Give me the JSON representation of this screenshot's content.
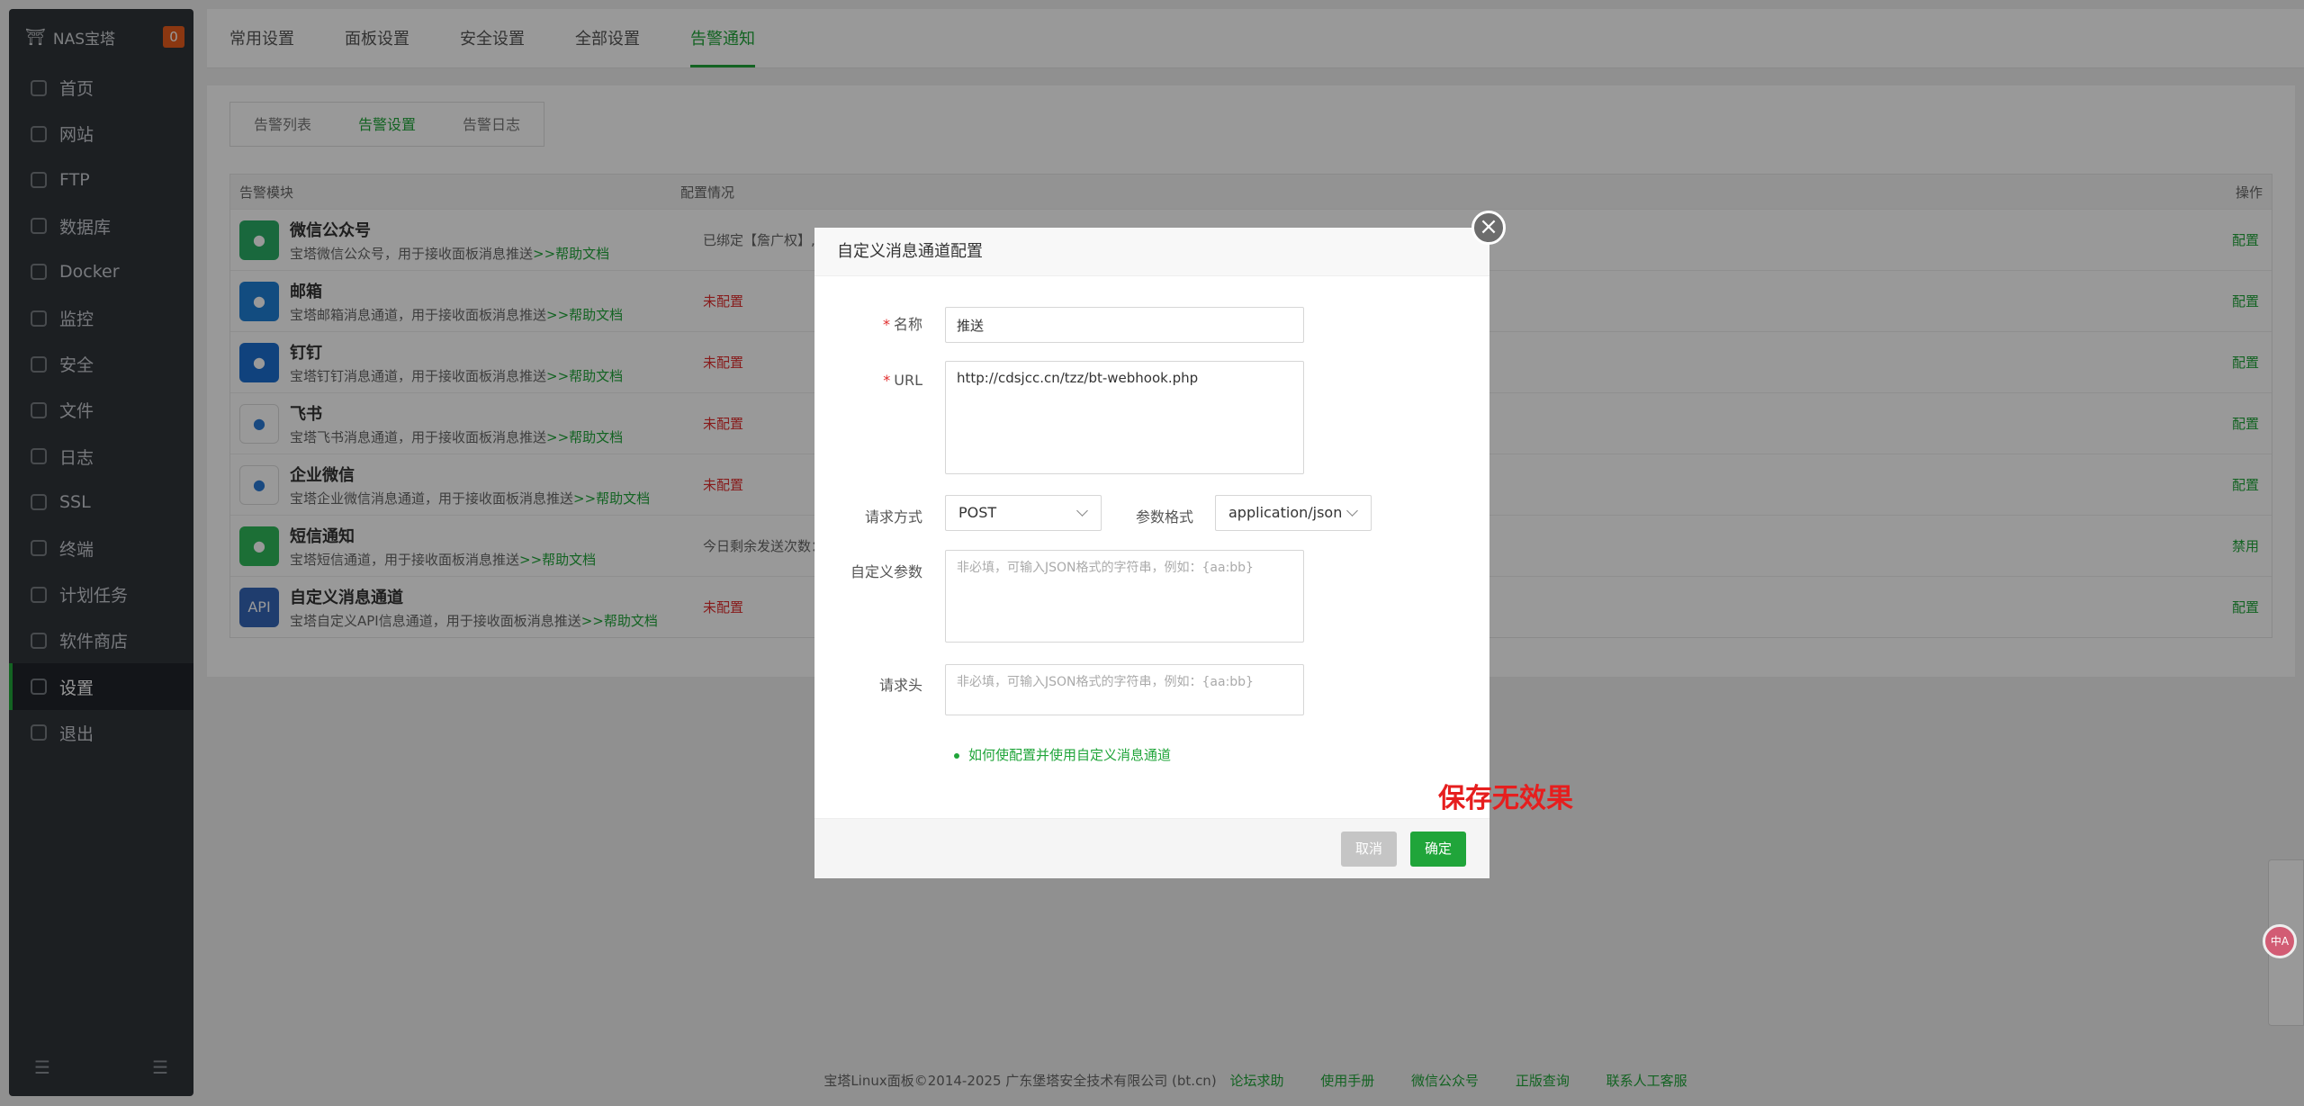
{
  "sidebar": {
    "logo": "NAS宝塔",
    "badge": "0",
    "items": [
      {
        "label": "首页"
      },
      {
        "label": "网站"
      },
      {
        "label": "FTP"
      },
      {
        "label": "数据库"
      },
      {
        "label": "Docker"
      },
      {
        "label": "监控"
      },
      {
        "label": "安全"
      },
      {
        "label": "文件"
      },
      {
        "label": "日志"
      },
      {
        "label": "SSL"
      },
      {
        "label": "终端"
      },
      {
        "label": "计划任务"
      },
      {
        "label": "软件商店"
      },
      {
        "label": "设置"
      },
      {
        "label": "退出"
      }
    ],
    "active_index": 13
  },
  "top_tabs": [
    "常用设置",
    "面板设置",
    "安全设置",
    "全部设置",
    "告警通知"
  ],
  "sub_tabs": [
    "告警列表",
    "告警设置",
    "告警日志"
  ],
  "table": {
    "headers": {
      "module": "告警模块",
      "config": "配置情况",
      "op": "操作"
    },
    "rows": [
      {
        "title": "微信公众号",
        "desc": "宝塔微信公众号，用于接收面板消息推送",
        "help": ">>帮助文档",
        "config": "已绑定【詹广权】,可",
        "op": "配置",
        "icon_color": "#2aae67",
        "icon": "wechat-icon"
      },
      {
        "title": "邮箱",
        "desc": "宝塔邮箱消息通道，用于接收面板消息推送",
        "help": ">>帮助文档",
        "config": "未配置",
        "op": "配置",
        "icon_color": "#1f7fd6",
        "icon": "mail-icon"
      },
      {
        "title": "钉钉",
        "desc": "宝塔钉钉消息通道，用于接收面板消息推送",
        "help": ">>帮助文档",
        "config": "未配置",
        "op": "配置",
        "icon_color": "#1b6ed1",
        "icon": "dingtalk-icon"
      },
      {
        "title": "飞书",
        "desc": "宝塔飞书消息通道，用于接收面板消息推送",
        "help": ">>帮助文档",
        "config": "未配置",
        "op": "配置",
        "icon_color": "#ffffff",
        "icon": "feishu-icon"
      },
      {
        "title": "企业微信",
        "desc": "宝塔企业微信消息通道，用于接收面板消息推送",
        "help": ">>帮助文档",
        "config": "未配置",
        "op": "配置",
        "icon_color": "#ffffff",
        "icon": "wecom-icon"
      },
      {
        "title": "短信通知",
        "desc": "宝塔短信通道，用于接收面板消息推送",
        "help": ">>帮助文档",
        "config": "今日剩余发送次数：",
        "op": "禁用",
        "icon_color": "#2fb95b",
        "icon": "sms-icon"
      },
      {
        "title": "自定义消息通道",
        "desc": "宝塔自定义API信息通道，用于接收面板消息推送",
        "help": ">>帮助文档",
        "config": "未配置",
        "op": "配置",
        "icon_color": "#3566b8",
        "icon": "api-icon"
      }
    ]
  },
  "footer": {
    "copyright": "宝塔Linux面板©2014-2025 广东堡塔安全技术有限公司 (bt.cn)",
    "links": [
      "论坛求助",
      "使用手册",
      "微信公众号",
      "正版查询",
      "联系人工客服"
    ]
  },
  "modal": {
    "title": "自定义消息通道配置",
    "name_label": "名称",
    "name_value": "推送",
    "url_label": "URL",
    "url_value": "http://cdsjcc.cn/tzz/bt-webhook.php",
    "method_label": "请求方式",
    "method_value": "POST",
    "format_label": "参数格式",
    "format_value": "application/json",
    "params_label": "自定义参数",
    "params_placeholder": "非必填，可输入JSON格式的字符串，例如：{aa:bb}",
    "headers_label": "请求头",
    "headers_placeholder": "非必填，可输入JSON格式的字符串，例如：{aa:bb}",
    "help_link": "如何使配置并使用自定义消息通道",
    "cancel": "取消",
    "confirm": "确定"
  },
  "annotation": "保存无效果",
  "translate_badge": "中A",
  "colors": {
    "accent": "#20a53a",
    "danger": "#e12d2d",
    "sidebar": "#30343a"
  }
}
